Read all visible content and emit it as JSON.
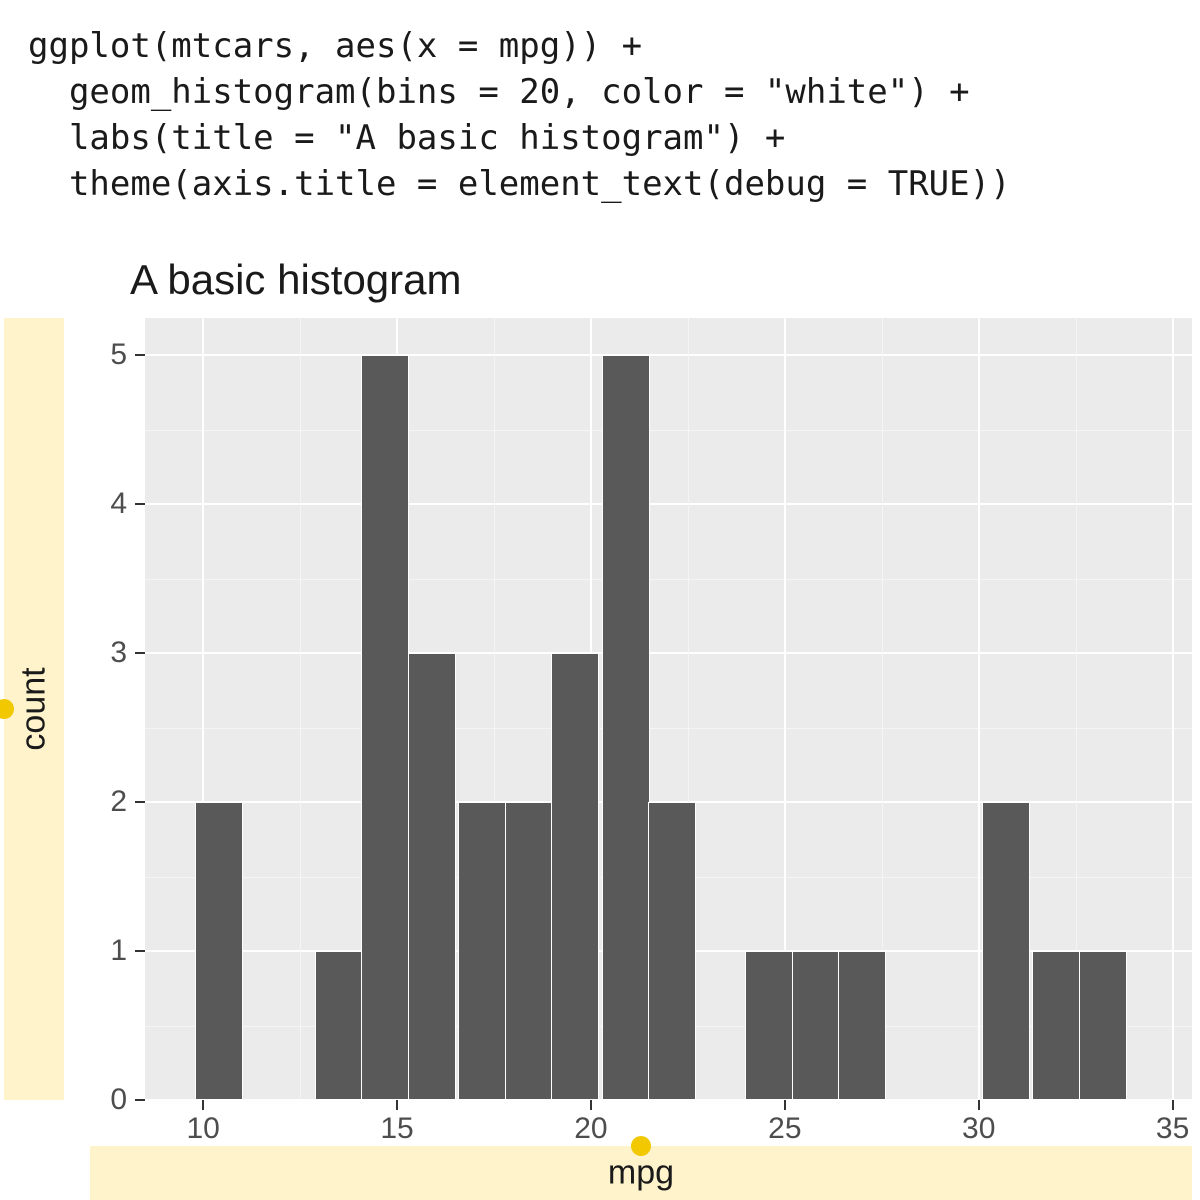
{
  "code": "ggplot(mtcars, aes(x = mpg)) +\n  geom_histogram(bins = 20, color = \"white\") +\n  labs(title = \"A basic histogram\") +\n  theme(axis.title = element_text(debug = TRUE))",
  "chart_data": {
    "type": "bar",
    "title": "A basic histogram",
    "xlabel": "mpg",
    "ylabel": "count",
    "xlim": [
      8.5,
      35.5
    ],
    "ylim": [
      0,
      5.25
    ],
    "x_ticks": [
      10,
      15,
      20,
      25,
      30,
      35
    ],
    "y_ticks": [
      0,
      1,
      2,
      3,
      4,
      5
    ],
    "x_minor": [
      12.5,
      17.5,
      22.5,
      27.5,
      32.5
    ],
    "y_minor": [
      0.5,
      1.5,
      2.5,
      3.5,
      4.5
    ],
    "bin_width": 1.24,
    "bins": [
      {
        "x": 10.4,
        "count": 2
      },
      {
        "x": 13.5,
        "count": 1
      },
      {
        "x": 14.7,
        "count": 5
      },
      {
        "x": 15.9,
        "count": 3
      },
      {
        "x": 17.2,
        "count": 2
      },
      {
        "x": 18.4,
        "count": 2
      },
      {
        "x": 19.6,
        "count": 3
      },
      {
        "x": 20.9,
        "count": 5
      },
      {
        "x": 22.1,
        "count": 2
      },
      {
        "x": 24.6,
        "count": 1
      },
      {
        "x": 25.8,
        "count": 1
      },
      {
        "x": 27.0,
        "count": 1
      },
      {
        "x": 30.7,
        "count": 2
      },
      {
        "x": 32.0,
        "count": 1
      },
      {
        "x": 33.2,
        "count": 1
      }
    ],
    "colors": {
      "panel_bg": "#ebebeb",
      "grid_major": "#ffffff",
      "bar_fill": "#595959",
      "bar_outline": "#ffffff",
      "debug_bg": "#fff3cc",
      "debug_dot": "#f2c800"
    }
  }
}
